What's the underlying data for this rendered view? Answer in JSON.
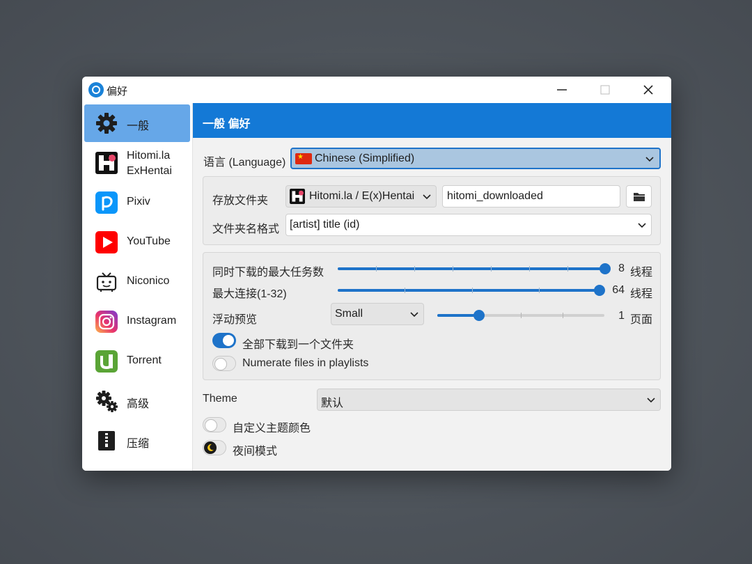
{
  "window": {
    "title": "偏好"
  },
  "sidebar": {
    "items": [
      {
        "label": "一般",
        "icon": "gear-icon",
        "active": true
      },
      {
        "label_line1": "Hitomi.la",
        "label_line2": "ExHentai",
        "icon": "hitomi-icon"
      },
      {
        "label": "Pixiv",
        "icon": "pixiv-icon"
      },
      {
        "label": "YouTube",
        "icon": "youtube-icon"
      },
      {
        "label": "Niconico",
        "icon": "niconico-icon"
      },
      {
        "label": "Instagram",
        "icon": "instagram-icon"
      },
      {
        "label": "Torrent",
        "icon": "utorrent-icon"
      },
      {
        "label": "高级",
        "icon": "gears-icon"
      },
      {
        "label": "压缩",
        "icon": "zip-icon"
      }
    ]
  },
  "header": {
    "title": "一般 偏好"
  },
  "language": {
    "label": "语言 (Language)",
    "value": "Chinese (Simplified)"
  },
  "storage": {
    "folder_label": "存放文件夹",
    "site_value": "Hitomi.la / E(x)Hentai",
    "folder_value": "hitomi_downloaded",
    "format_label": "文件夹名格式",
    "format_value": "[artist] title (id)"
  },
  "download": {
    "max_tasks_label": "同时下载的最大任务数",
    "max_tasks_value": "8",
    "max_tasks_fraction": 1.0,
    "unit_threads": "线程",
    "max_conn_label": "最大连接(1-32)",
    "max_conn_value": "64",
    "max_conn_fraction": 1.0,
    "float_preview_label": "浮动预览",
    "float_preview_size": "Small",
    "float_preview_value": "1",
    "float_preview_fraction": 0.25,
    "unit_pages": "页面",
    "all_in_one_label": "全部下载到一个文件夹",
    "all_in_one_on": true,
    "numerate_label": "Numerate files in playlists",
    "numerate_on": false
  },
  "theme": {
    "label": "Theme",
    "value": "默认",
    "custom_color_label": "自定义主题颜色",
    "custom_color_on": false,
    "night_mode_label": "夜间模式",
    "night_mode_on": false
  },
  "colors": {
    "accent": "#1479d6",
    "selected": "#66a7e8",
    "background": "#4d535a"
  }
}
